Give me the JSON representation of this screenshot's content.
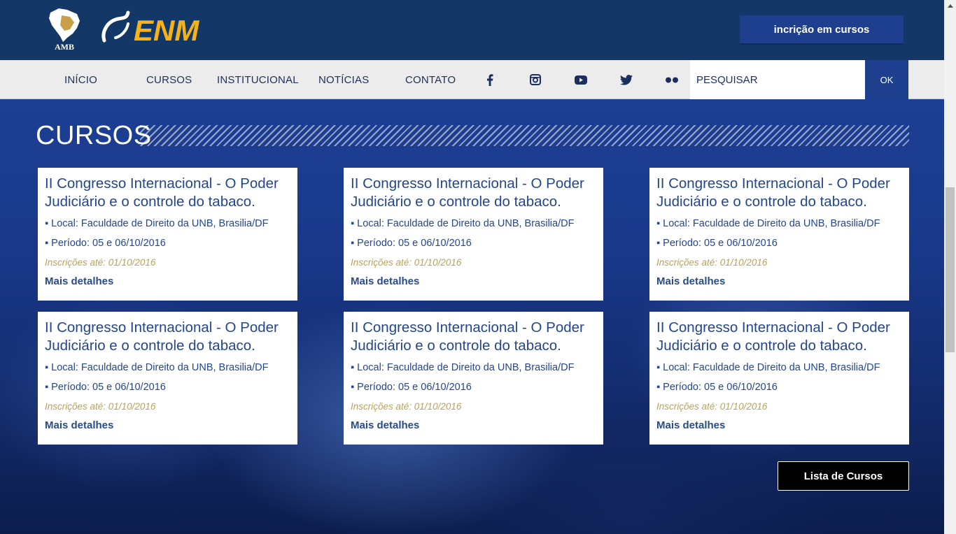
{
  "header": {
    "logo_amb_text": "AMB",
    "logo_enm_text": "ENM",
    "enroll_button": "incrição em cursos"
  },
  "nav": {
    "items": [
      "INÍCIO",
      "CURSOS",
      "INSTITUCIONAL",
      "NOTÍCIAS",
      "CONTATO"
    ],
    "social": [
      "facebook-icon",
      "instagram-icon",
      "youtube-icon",
      "twitter-icon",
      "flickr-icon"
    ],
    "search_placeholder": "PESQUISAR",
    "search_button": "OK"
  },
  "section": {
    "title": "CURSOS"
  },
  "courses": [
    {
      "title": "II Congresso Internacional - O Poder Judiciário e o controle do tabaco.",
      "local": "Local: Faculdade de Direito da UNB, Brasilia/DF",
      "period": "Período: 05 e 06/10/2016",
      "deadline": "Inscrições até: 01/10/2016",
      "link": "Mais detalhes"
    },
    {
      "title": "II Congresso Internacional - O Poder Judiciário e o controle do tabaco.",
      "local": "Local: Faculdade de Direito da UNB, Brasilia/DF",
      "period": "Período: 05 e 06/10/2016",
      "deadline": "Inscrições até: 01/10/2016",
      "link": "Mais detalhes"
    },
    {
      "title": "II Congresso Internacional - O Poder Judiciário e o controle do tabaco.",
      "local": "Local: Faculdade de Direito da UNB, Brasilia/DF",
      "period": "Período: 05 e 06/10/2016",
      "deadline": "Inscrições até: 01/10/2016",
      "link": "Mais detalhes"
    },
    {
      "title": "II Congresso Internacional - O Poder Judiciário e o controle do tabaco.",
      "local": "Local: Faculdade de Direito da UNB, Brasilia/DF",
      "period": "Período: 05 e 06/10/2016",
      "deadline": "Inscrições até: 01/10/2016",
      "link": "Mais detalhes"
    },
    {
      "title": "II Congresso Internacional - O Poder Judiciário e o controle do tabaco.",
      "local": "Local: Faculdade de Direito da UNB, Brasilia/DF",
      "period": "Período: 05 e 06/10/2016",
      "deadline": "Inscrições até: 01/10/2016",
      "link": "Mais detalhes"
    },
    {
      "title": "II Congresso Internacional - O Poder Judiciário e o controle do tabaco.",
      "local": "Local: Faculdade de Direito da UNB, Brasilia/DF",
      "period": "Período: 05 e 06/10/2016",
      "deadline": "Inscrições até: 01/10/2016",
      "link": "Mais detalhes"
    }
  ],
  "list_button": "Lista de Cursos",
  "colors": {
    "header_bg": "#133867",
    "nav_bg": "#ececec",
    "accent_blue": "#1e3f8e",
    "card_text": "#24468f",
    "deadline_gold": "#b9a25a",
    "enm_yellow": "#f5b21a"
  }
}
